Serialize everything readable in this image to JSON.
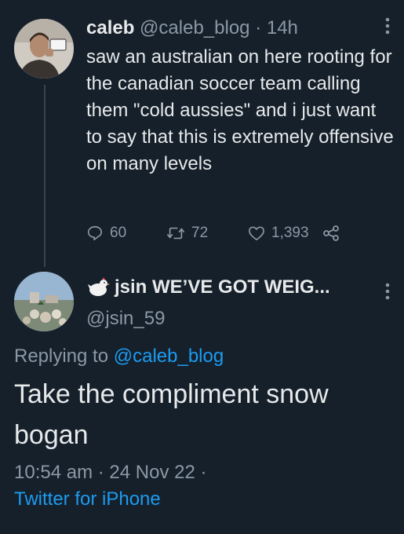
{
  "tweet1": {
    "name": "caleb",
    "handle": "@caleb_blog",
    "sep": "·",
    "time": "14h",
    "text": "saw an australian on here rooting for the canadian soccer team calling them \"cold aussies\" and i just want to say that this is extremely offensive on many levels",
    "replies": "60",
    "retweets": "72",
    "likes": "1,393"
  },
  "tweet2": {
    "name": "jsin WE’VE GOT WEIG...",
    "handle": "@jsin_59",
    "replying_prefix": "Replying to ",
    "replying_handle": "@caleb_blog",
    "text": "Take the compliment snow bogan",
    "time": "10:54 am",
    "sep1": "·",
    "date": "24 Nov 22",
    "sep2": "·",
    "source": "Twitter for iPhone"
  },
  "colors": {
    "background": "#15202b",
    "text": "#e7e9ea",
    "muted": "#8b98a5",
    "link": "#1d9bf0"
  }
}
